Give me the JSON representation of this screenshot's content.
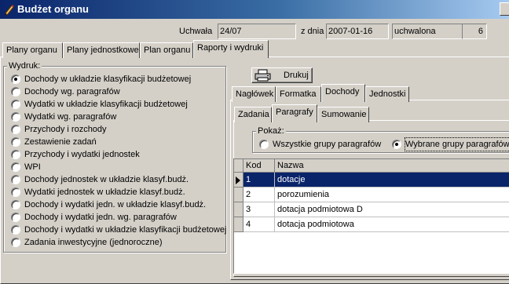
{
  "window": {
    "title": "Budżet organu",
    "icon": "pen-icon"
  },
  "header": {
    "uchwala_label": "Uchwała",
    "uchwala_value": "24/07",
    "date_label": "z dnia",
    "date_value": "2007-01-16",
    "status_value": "uchwalona",
    "number_value": "6"
  },
  "main_tabs": [
    "Plany organu",
    "Plany jednostkowe",
    "Plan organu",
    "Raporty i wydruki"
  ],
  "wydruk": {
    "label": "Wydruk:",
    "options": [
      "Dochody w układzie klasyfikacji budżetowej",
      "Dochody wg. paragrafów",
      "Wydatki w układzie klasyfikacji budżetowej",
      "Wydatki wg. paragrafów",
      "Przychody i rozchody",
      "Zestawienie zadań",
      "Przychody i wydatki jednostek",
      "WPI",
      "Dochody jednostek w układzie klasyf.budż.",
      "Wydatki jednostek w układzie klasyf.budż.",
      "Dochody i wydatki jedn. w układzie klasyf.budż.",
      "Dochody i wydatki jedn. wg. paragrafów",
      "Dochody i wydatki w układzie klasyfikacji budżetowej",
      "Zadania inwestycyjne (jednoroczne)"
    ],
    "selected_index": 0
  },
  "print_button": {
    "label": "Drukuj",
    "icon": "printer-icon"
  },
  "report_tabs": [
    "Nagłówek",
    "Formatka",
    "Dochody",
    "Jednostki"
  ],
  "sub_tabs": [
    "Zadania",
    "Paragrafy",
    "Sumowanie"
  ],
  "pokaz": {
    "label": "Pokaż:",
    "options": [
      "Wszystkie grupy paragrafów",
      "Wybrane grupy paragrafów"
    ],
    "selected_index": 1
  },
  "grid": {
    "columns": [
      "Kod",
      "Nazwa"
    ],
    "rows": [
      {
        "kod": "1",
        "nazwa": "dotacje"
      },
      {
        "kod": "2",
        "nazwa": "porozumienia"
      },
      {
        "kod": "3",
        "nazwa": "dotacja podmiotowa D"
      },
      {
        "kod": "4",
        "nazwa": "dotacja podmiotowa"
      }
    ],
    "selected_row": 0
  }
}
